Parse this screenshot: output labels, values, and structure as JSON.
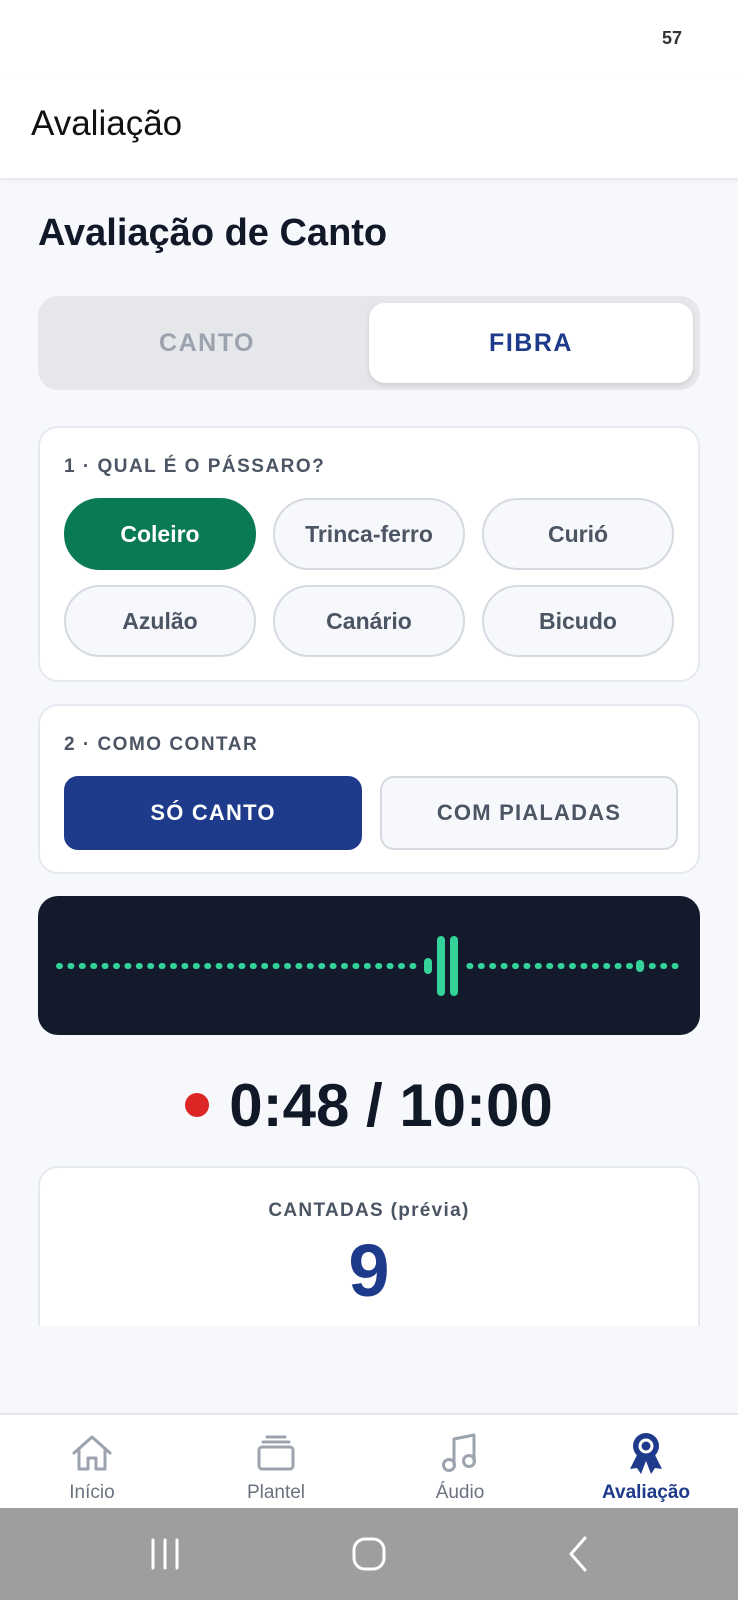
{
  "status_bar": {
    "battery": "57"
  },
  "header": {
    "title": "Avaliação"
  },
  "page": {
    "title": "Avaliação de Canto"
  },
  "segment": {
    "options": [
      "CANTO",
      "FIBRA"
    ],
    "selected": "FIBRA"
  },
  "bird_section": {
    "label": "1 · QUAL É O PÁSSARO?",
    "options": [
      "Coleiro",
      "Trinca-ferro",
      "Curió",
      "Azulão",
      "Canário",
      "Bicudo"
    ],
    "selected": "Coleiro"
  },
  "count_section": {
    "label": "2 · COMO CONTAR",
    "options": [
      "SÓ CANTO",
      "COM PIALADAS"
    ],
    "selected": "SÓ CANTO"
  },
  "recorder": {
    "timer": "0:48 / 10:00",
    "accent_color": "#34d399",
    "record_color": "#dc2626"
  },
  "count_card": {
    "label": "CANTADAS (prévia)",
    "value": "9"
  },
  "bottom_nav": {
    "items": [
      {
        "label": "Início",
        "icon": "home-icon"
      },
      {
        "label": "Plantel",
        "icon": "stack-icon"
      },
      {
        "label": "Áudio",
        "icon": "music-note-icon"
      },
      {
        "label": "Avaliação",
        "icon": "award-icon"
      }
    ],
    "active": "Avaliação"
  },
  "system_nav": {
    "icons": [
      "recents-icon",
      "home-circle-icon",
      "back-icon"
    ]
  },
  "colors": {
    "primary": "#1e3a8a",
    "success": "#0a7a55",
    "background": "#f6f8fb"
  }
}
